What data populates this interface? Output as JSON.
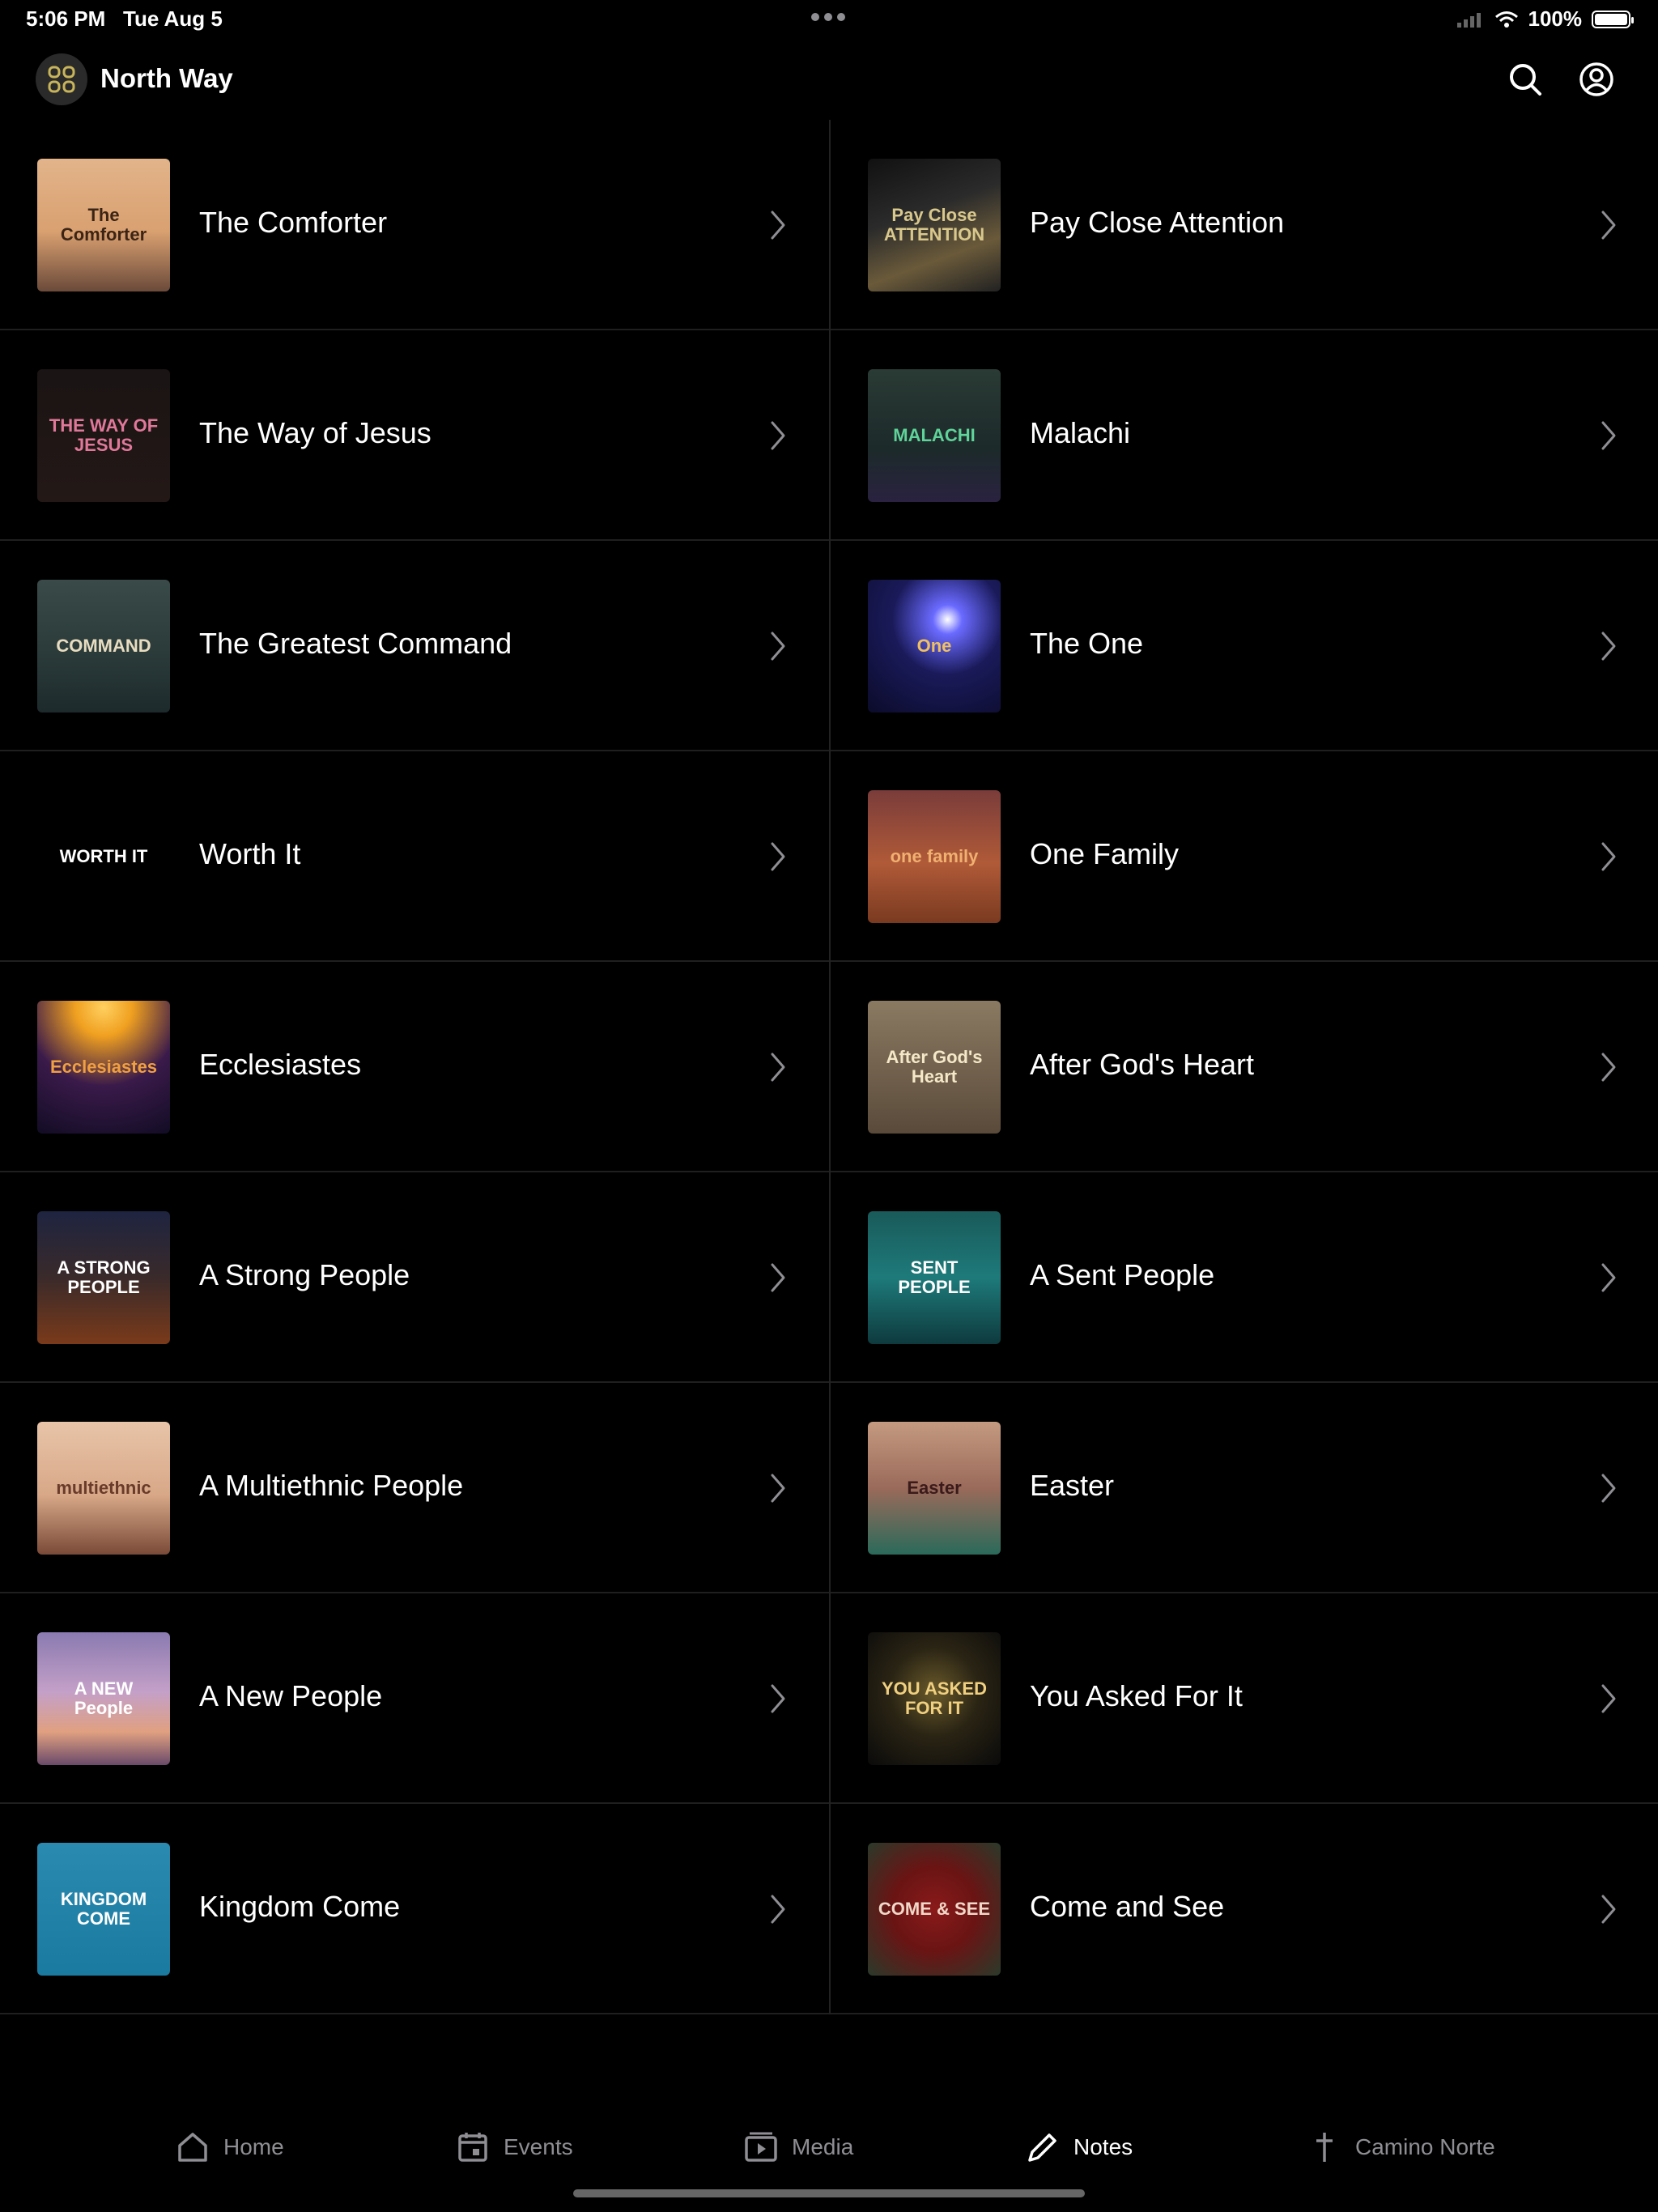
{
  "status": {
    "time": "5:06 PM",
    "date": "Tue Aug 5",
    "battery": "100%"
  },
  "header": {
    "title": "North Way"
  },
  "series": [
    {
      "title": "The Comforter",
      "thumb_text": "The Comforter",
      "thumb_bg": "linear-gradient(180deg,#e2b48a 0%,#d9a070 55%,#6b4a3a 100%)",
      "thumb_fg": "#3b2415"
    },
    {
      "title": "Pay Close Attention",
      "thumb_text": "Pay Close ATTENTION",
      "thumb_bg": "linear-gradient(160deg,#111 0%,#2b2b2b 40%,#6a5a3a 70%,#222 100%)",
      "thumb_fg": "#d9c88c"
    },
    {
      "title": "The Way of Jesus",
      "thumb_text": "THE WAY OF JESUS",
      "thumb_bg": "linear-gradient(180deg,#1a1414 0%,#231816 100%)",
      "thumb_fg": "#e0789a"
    },
    {
      "title": "Malachi",
      "thumb_text": "MALACHI",
      "thumb_bg": "linear-gradient(180deg,#2a3a34 0%,#1c2a2a 60%,#2a2240 100%)",
      "thumb_fg": "#5fd39a"
    },
    {
      "title": "The Greatest Command",
      "thumb_text": "COMMAND",
      "thumb_bg": "linear-gradient(180deg,#3a4a48 0%,#2b3b3a 55%,#1d2a2c 100%)",
      "thumb_fg": "#e8dcc0"
    },
    {
      "title": "The One",
      "thumb_text": "One",
      "thumb_bg": "radial-gradient(circle at 60% 30%,#ffffff 0%,#6a6aff 12%,#1a1a5a 45%,#0b0b2a 100%)",
      "thumb_fg": "#f0c060"
    },
    {
      "title": "Worth It",
      "thumb_text": "WORTH IT",
      "thumb_bg": "#000000",
      "thumb_fg": "#ffffff"
    },
    {
      "title": "One Family",
      "thumb_text": "one family",
      "thumb_bg": "linear-gradient(180deg,#7a3c3a 0%,#b05a38 55%,#7a3a20 100%)",
      "thumb_fg": "#f0b070"
    },
    {
      "title": "Ecclesiastes",
      "thumb_text": "Ecclesiastes",
      "thumb_bg": "radial-gradient(circle at 50% 5%,#ffd060 0%,#f0a020 20%,#3a1a4a 55%,#120c24 100%)",
      "thumb_fg": "#f0a040"
    },
    {
      "title": "After God's Heart",
      "thumb_text": "After God's Heart",
      "thumb_bg": "linear-gradient(180deg,#8a7a62 0%,#5a4a3a 100%)",
      "thumb_fg": "#f4e8c8"
    },
    {
      "title": "A Strong People",
      "thumb_text": "A STRONG PEOPLE",
      "thumb_bg": "linear-gradient(180deg,#1e2440 0%,#3a2a2a 50%,#7a3a1a 100%)",
      "thumb_fg": "#ffffff"
    },
    {
      "title": "A Sent People",
      "thumb_text": "SENT PEOPLE",
      "thumb_bg": "linear-gradient(180deg,#1a5a5a 0%,#1e7a7a 50%,#0e3a3e 100%)",
      "thumb_fg": "#ffffff"
    },
    {
      "title": "A Multiethnic People",
      "thumb_text": "multiethnic",
      "thumb_bg": "linear-gradient(180deg,#e8c4a8 0%,#d8a888 55%,#7a4a38 100%)",
      "thumb_fg": "#6a3a2a"
    },
    {
      "title": "Easter",
      "thumb_text": "Easter",
      "thumb_bg": "linear-gradient(180deg,#c49a80 0%,#9a6a5a 50%,#2a6a5a 100%)",
      "thumb_fg": "#3a1a1a"
    },
    {
      "title": "A New People",
      "thumb_text": "A NEW People",
      "thumb_bg": "linear-gradient(180deg,#8a7ab0 0%,#c4a0c8 45%,#e0a080 75%,#6a4a6a 100%)",
      "thumb_fg": "#ffffff"
    },
    {
      "title": "You Asked For It",
      "thumb_text": "YOU ASKED FOR IT",
      "thumb_bg": "radial-gradient(circle at 50% 45%,#6a5a2a 0%,#2a2414 45%,#0a0a0a 100%)",
      "thumb_fg": "#f0d080"
    },
    {
      "title": "Kingdom Come",
      "thumb_text": "KINGDOM COME",
      "thumb_bg": "linear-gradient(180deg,#2a8ab0 0%,#1a7aa0 100%)",
      "thumb_fg": "#ffffff"
    },
    {
      "title": "Come and See",
      "thumb_text": "COME & SEE",
      "thumb_bg": "radial-gradient(circle at 50% 50%,#8a1a1a 0%,#6a1414 45%,#2a3a2a 100%)",
      "thumb_fg": "#f0d8c8"
    }
  ],
  "tabs": [
    {
      "label": "Home",
      "icon": "home-icon",
      "active": false
    },
    {
      "label": "Events",
      "icon": "calendar-icon",
      "active": false
    },
    {
      "label": "Media",
      "icon": "media-icon",
      "active": false
    },
    {
      "label": "Notes",
      "icon": "pencil-icon",
      "active": true
    },
    {
      "label": "Camino Norte",
      "icon": "cross-icon",
      "active": false
    }
  ]
}
